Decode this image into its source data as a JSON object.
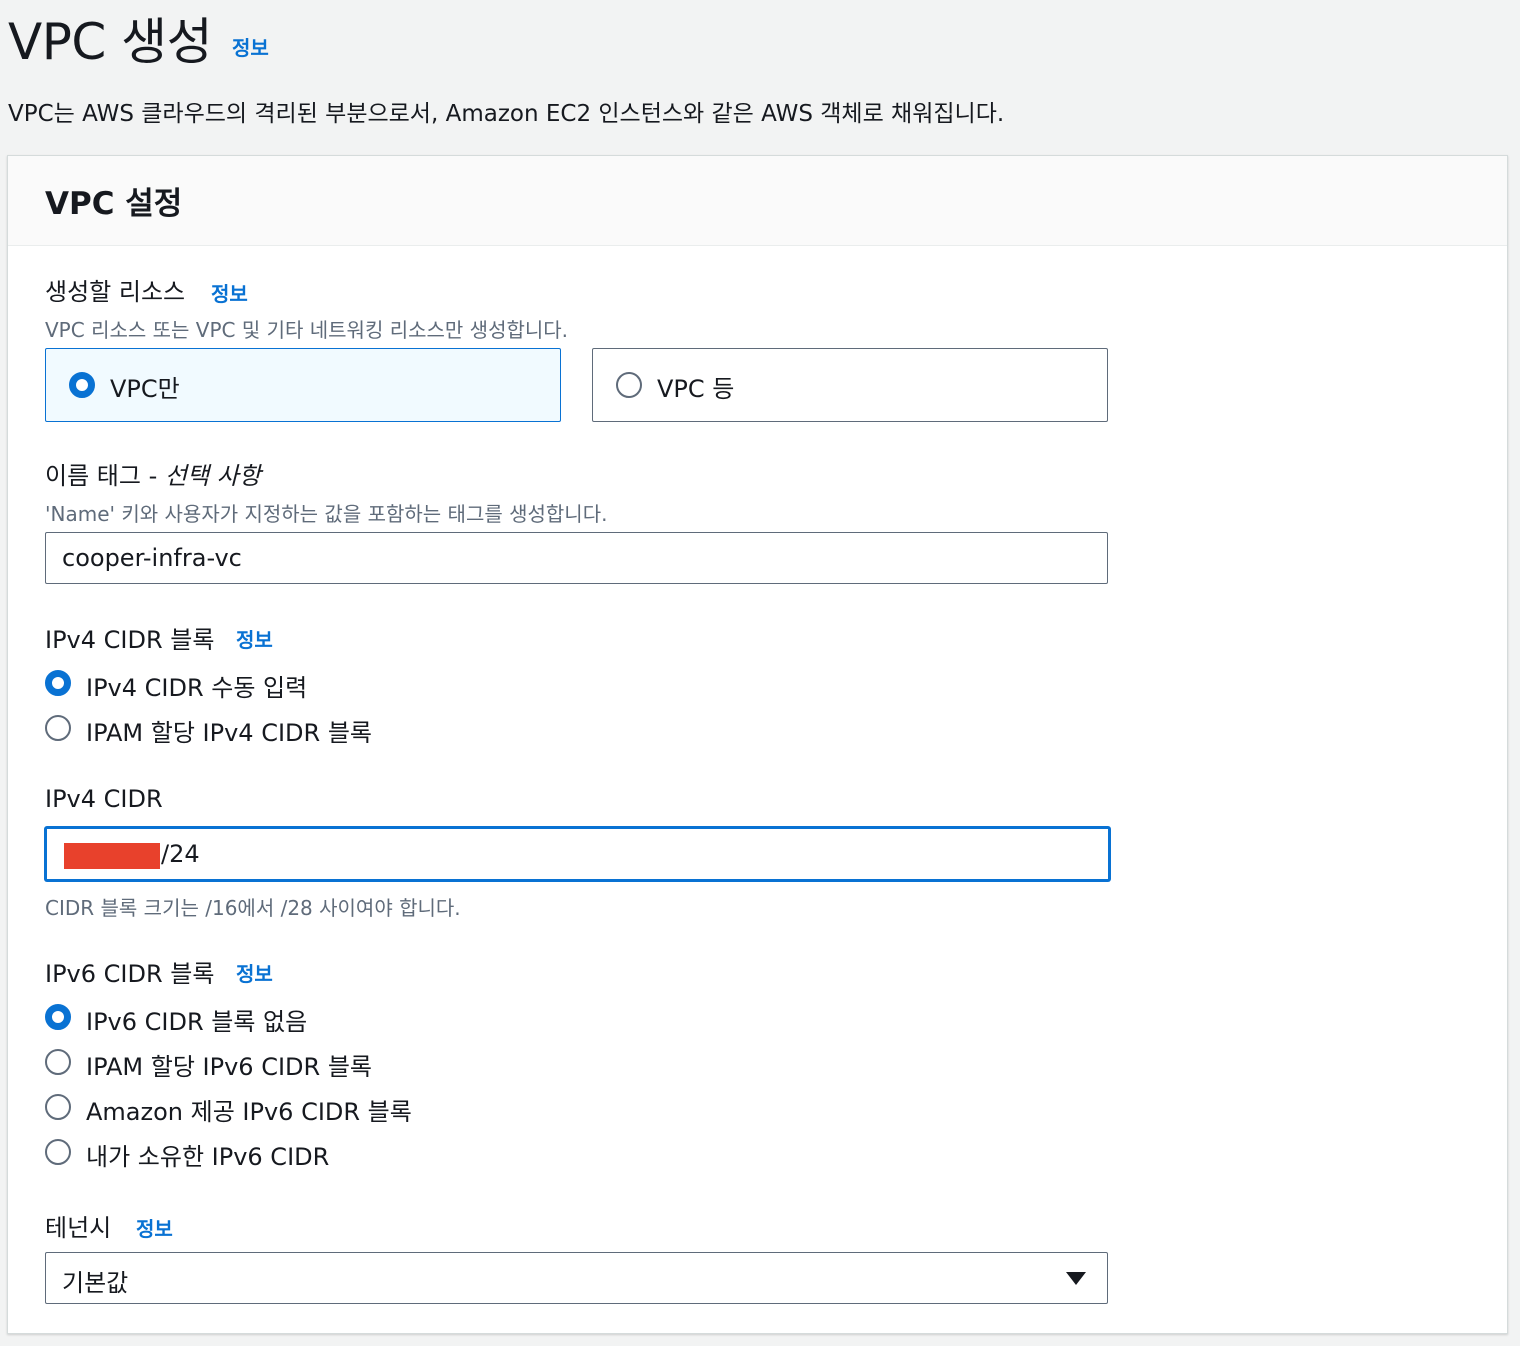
{
  "page": {
    "title": "VPC 생성",
    "info": "정보",
    "description": "VPC는 AWS 클라우드의 격리된 부분으로서, Amazon EC2 인스턴스와 같은 AWS 객체로 채워집니다."
  },
  "panel": {
    "title": "VPC 설정",
    "resources": {
      "label": "생성할 리소스",
      "info": "정보",
      "hint": "VPC 리소스 또는 VPC 및 기타 네트워킹 리소스만 생성합니다.",
      "options": [
        "VPC만",
        "VPC 등"
      ],
      "selected": "VPC만"
    },
    "name_tag": {
      "label": "이름 태그 - ",
      "optional": "선택 사항",
      "hint": "'Name' 키와 사용자가 지정하는 값을 포함하는 태그를 생성합니다.",
      "value": "cooper-infra-vc"
    },
    "ipv4_block": {
      "label": "IPv4 CIDR 블록",
      "info": "정보",
      "options": [
        "IPv4 CIDR 수동 입력",
        "IPAM 할당 IPv4 CIDR 블록"
      ],
      "selected": "IPv4 CIDR 수동 입력"
    },
    "ipv4_cidr": {
      "label": "IPv4 CIDR",
      "value_suffix": "/24",
      "hint": "CIDR 블록 크기는 /16에서 /28 사이여야 합니다."
    },
    "ipv6_block": {
      "label": "IPv6 CIDR 블록",
      "info": "정보",
      "options": [
        "IPv6 CIDR 블록 없음",
        "IPAM 할당 IPv6 CIDR 블록",
        "Amazon 제공 IPv6 CIDR 블록",
        "내가 소유한 IPv6 CIDR"
      ],
      "selected": "IPv6 CIDR 블록 없음"
    },
    "tenancy": {
      "label": "테넌시",
      "info": "정보",
      "value": "기본값"
    }
  },
  "colors": {
    "accent": "#0972d3",
    "redaction": "#e8412c",
    "background": "#f2f3f3"
  }
}
